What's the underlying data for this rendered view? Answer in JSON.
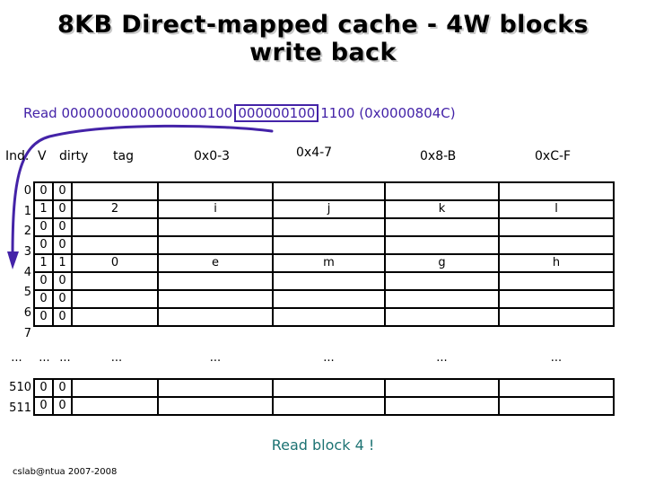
{
  "slide": {
    "title_line1": "8KB Direct-mapped cache - 4W blocks",
    "title_line2": "write back",
    "footer_credit": "cslab@ntua 2007-2008",
    "bottom_note": "Read block 4 !",
    "accent_purple": "#4423a8",
    "accent_teal": "#1d7373"
  },
  "read_line": {
    "label": "Read",
    "tag_bits": "00000000000000000100",
    "index_bits": "000000100",
    "offset_bits": "1100",
    "hex": "(0x0000804C)"
  },
  "table": {
    "headers": {
      "index": "Ind.",
      "valid": "V",
      "dirty": "dirty",
      "tag": "tag",
      "w0": "0x0-3",
      "w1": "0x4-7",
      "w2": "0x8-B",
      "w3": "0xC-F"
    },
    "rows": [
      {
        "index": "0",
        "v": "0",
        "d": "0",
        "tag": "",
        "w0": "",
        "w1": "",
        "w2": "",
        "w3": ""
      },
      {
        "index": "1",
        "v": "1",
        "d": "0",
        "tag": "2",
        "w0": "i",
        "w1": "j",
        "w2": "k",
        "w3": "l"
      },
      {
        "index": "2",
        "v": "0",
        "d": "0",
        "tag": "",
        "w0": "",
        "w1": "",
        "w2": "",
        "w3": ""
      },
      {
        "index": "3",
        "v": "0",
        "d": "0",
        "tag": "",
        "w0": "",
        "w1": "",
        "w2": "",
        "w3": ""
      },
      {
        "index": "4",
        "v": "1",
        "d": "1",
        "tag": "0",
        "w0": "e",
        "w1": "m",
        "w2": "g",
        "w3": "h"
      },
      {
        "index": "5",
        "v": "0",
        "d": "0",
        "tag": "",
        "w0": "",
        "w1": "",
        "w2": "",
        "w3": ""
      },
      {
        "index": "6",
        "v": "0",
        "d": "0",
        "tag": "",
        "w0": "",
        "w1": "",
        "w2": "",
        "w3": ""
      },
      {
        "index": "7",
        "v": "0",
        "d": "0",
        "tag": "",
        "w0": "",
        "w1": "",
        "w2": "",
        "w3": ""
      }
    ],
    "ellipsis": {
      "index": "...",
      "v": "...",
      "d": "...",
      "tag": "...",
      "w0": "...",
      "w1": "...",
      "w2": "...",
      "w3": "..."
    },
    "tail_rows": [
      {
        "index": "510",
        "v": "0",
        "d": "0",
        "tag": "",
        "w0": "",
        "w1": "",
        "w2": "",
        "w3": ""
      },
      {
        "index": "511",
        "v": "0",
        "d": "0",
        "tag": "",
        "w0": "",
        "w1": "",
        "w2": "",
        "w3": ""
      }
    ]
  }
}
